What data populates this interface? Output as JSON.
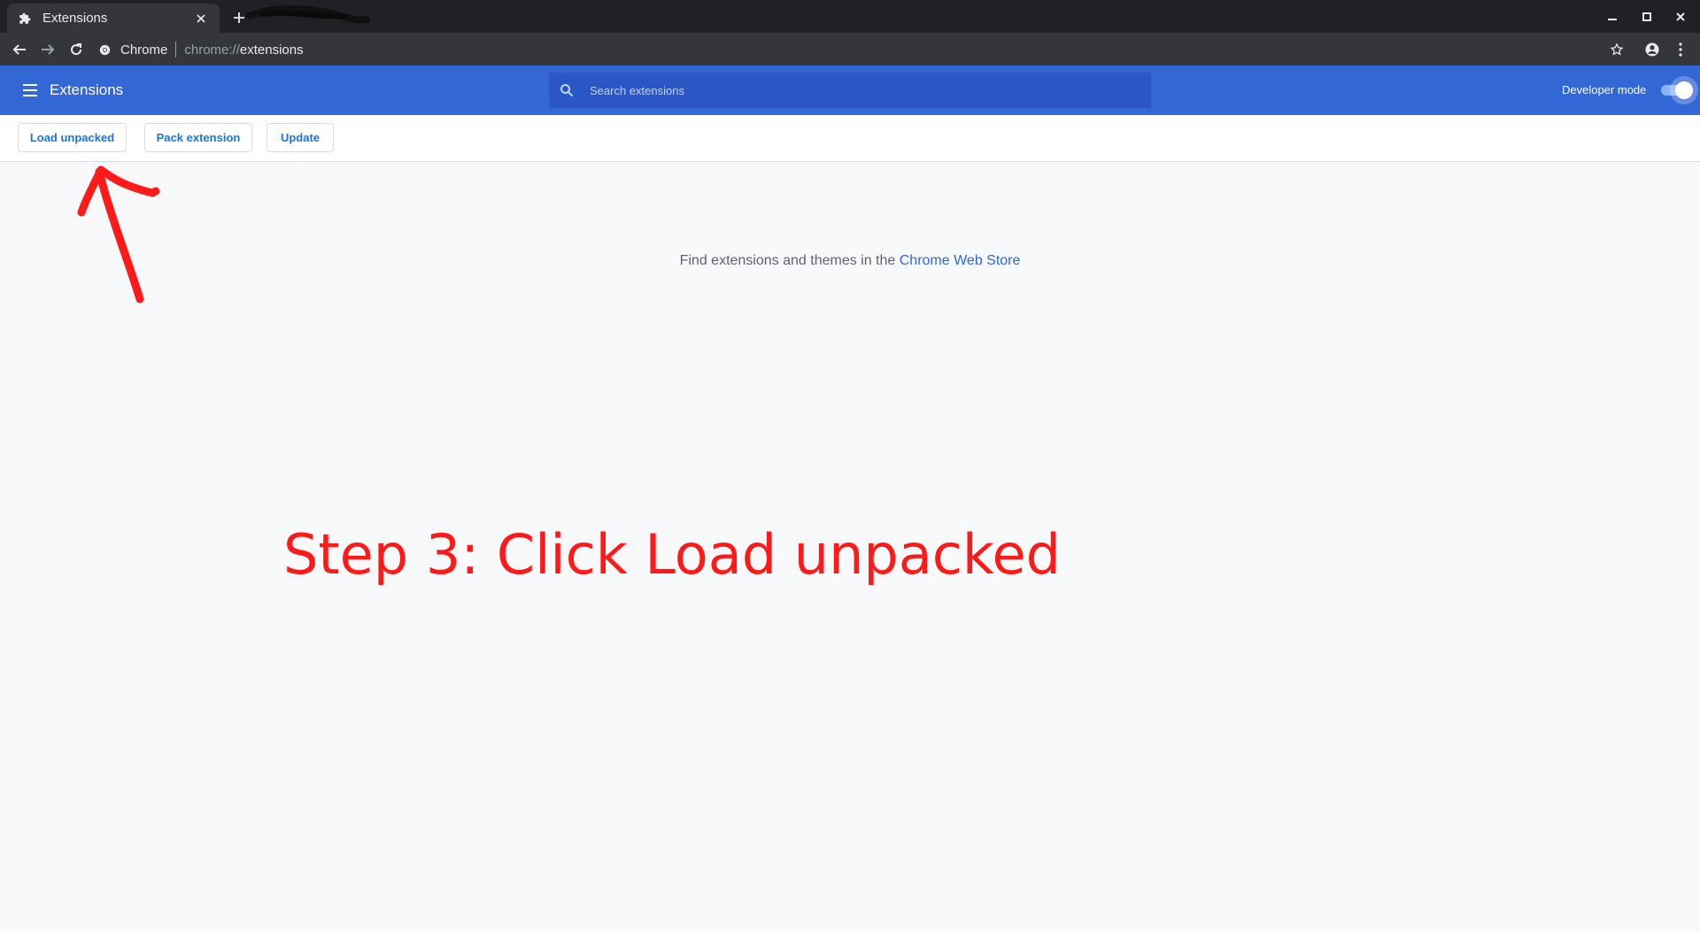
{
  "tab": {
    "title": "Extensions",
    "favicon": "puzzle-icon"
  },
  "omnibox": {
    "chip_label": "Chrome",
    "url_scheme": "chrome://",
    "url_host": "extensions"
  },
  "header": {
    "title": "Extensions",
    "search_placeholder": "Search extensions",
    "developer_mode_label": "Developer mode",
    "developer_mode_on": true
  },
  "dev_toolbar": {
    "load_unpacked": "Load unpacked",
    "pack_extension": "Pack extension",
    "update": "Update"
  },
  "main": {
    "store_prefix": "Find extensions and themes in the ",
    "store_link": "Chrome Web Store"
  },
  "annotation": {
    "step_text": "Step 3: Click Load unpacked"
  },
  "colors": {
    "header_blue": "#3367d6",
    "link_blue": "#1a73e8",
    "annotation_red": "#ff1a1a",
    "titlebar_dark": "#202124"
  }
}
